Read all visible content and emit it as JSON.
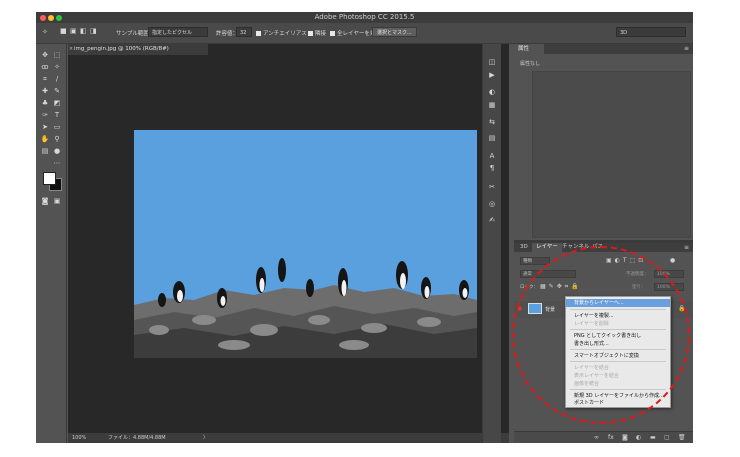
{
  "window": {
    "title": "Adobe Photoshop CC 2015.5"
  },
  "options_bar": {
    "sample_size_label": "サンプル範囲：",
    "sample_size_value": "指定したピクセル",
    "tolerance_label": "許容値：",
    "tolerance_value": "32",
    "antialias_label": "アンチエイリアス",
    "contiguous_label": "隣接",
    "sample_all_layers_label": "全レイヤーを対象",
    "select_and_mask_label": "選択とマスク...",
    "workspace_value": "3D"
  },
  "document": {
    "tab_label": "img_pengin.jpg @ 100% (RGB/8#)",
    "close_glyph": "×"
  },
  "status_bar": {
    "zoom": "100%",
    "file_info": "ファイル：4.88M/4.88M",
    "arrow": "〉"
  },
  "properties_panel": {
    "tab_label": "属性",
    "empty_text": "属性なし"
  },
  "layers_panel": {
    "tabs": [
      {
        "label": "3D"
      },
      {
        "label": "レイヤー"
      },
      {
        "label": "チャンネル"
      },
      {
        "label": "パス"
      }
    ],
    "filter_kind": "種類",
    "blend_mode": "通常",
    "opacity_label": "不透明度：",
    "opacity_value": "100%",
    "lock_label": "ロック：",
    "fill_label": "塗り：",
    "fill_value": "100%",
    "layer_name": "背景"
  },
  "context_menu": {
    "items": [
      {
        "label": "背景からレイヤーへ...",
        "state": "highlighted"
      },
      {
        "label": "レイヤーを複製...",
        "state": "enabled"
      },
      {
        "label": "レイヤーを削除",
        "state": "disabled"
      },
      {
        "label": "PNG としてクイック書き出し",
        "state": "enabled"
      },
      {
        "label": "書き出し形式...",
        "state": "enabled"
      },
      {
        "label": "スマートオブジェクトに変換",
        "state": "enabled"
      },
      {
        "label": "レイヤーを結合",
        "state": "disabled"
      },
      {
        "label": "表示レイヤーを結合",
        "state": "disabled"
      },
      {
        "label": "画像を統合",
        "state": "disabled"
      },
      {
        "label": "新規 3D レイヤーをファイルから作成...",
        "state": "enabled"
      },
      {
        "label": "ポストカード",
        "state": "enabled"
      }
    ]
  },
  "colors": {
    "accent_highlight": "#6a9fdf",
    "annotation_red": "#e01818",
    "sky_blue": "#5aa0df"
  }
}
